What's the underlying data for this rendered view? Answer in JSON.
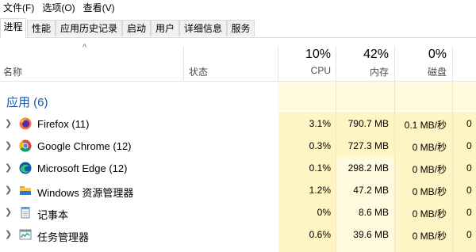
{
  "menu": [
    "文件(F)",
    "选项(O)",
    "查看(V)"
  ],
  "tabs": [
    "进程",
    "性能",
    "应用历史记录",
    "启动",
    "用户",
    "详细信息",
    "服务"
  ],
  "header": {
    "sort_arrow": "^",
    "name": "名称",
    "status": "状态",
    "cpu_pct": "10%",
    "cpu_label": "CPU",
    "mem_pct": "42%",
    "mem_label": "内存",
    "disk_pct": "0%",
    "disk_label": "磁盘"
  },
  "group": {
    "title": "应用 (6)"
  },
  "rows": [
    {
      "name": "Firefox (11)",
      "icon": "firefox-icon",
      "cpu": "3.1%",
      "mem": "790.7 MB",
      "disk": "0.1 MB/秒",
      "net": "0"
    },
    {
      "name": "Google Chrome (12)",
      "icon": "chrome-icon",
      "cpu": "0.3%",
      "mem": "727.3 MB",
      "disk": "0 MB/秒",
      "net": "0"
    },
    {
      "name": "Microsoft Edge (12)",
      "icon": "edge-icon",
      "cpu": "0.1%",
      "mem": "298.2 MB",
      "disk": "0 MB/秒",
      "net": "0"
    },
    {
      "name": "Windows 资源管理器",
      "icon": "file-explorer-icon",
      "cpu": "1.2%",
      "mem": "47.2 MB",
      "disk": "0 MB/秒",
      "net": "0"
    },
    {
      "name": "记事本",
      "icon": "notepad-icon",
      "cpu": "0%",
      "mem": "8.6 MB",
      "disk": "0 MB/秒",
      "net": "0"
    },
    {
      "name": "任务管理器",
      "icon": "task-manager-icon",
      "cpu": "0.6%",
      "mem": "39.6 MB",
      "disk": "0 MB/秒",
      "net": "0"
    }
  ],
  "colors": {
    "accent": "#1c58a8",
    "heat_strong": "#fff4c4",
    "heat_light": "#fff9dd"
  }
}
